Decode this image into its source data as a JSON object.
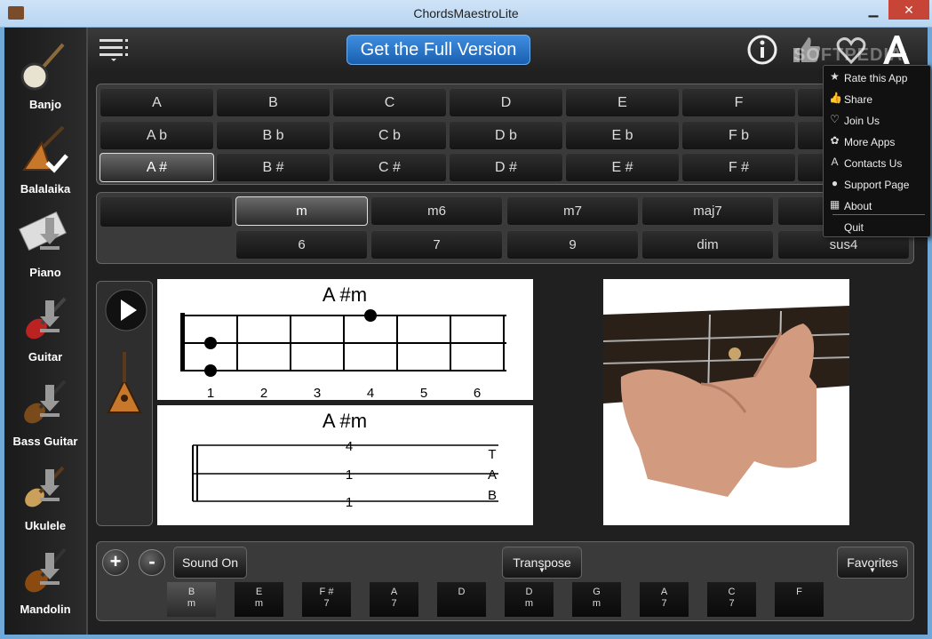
{
  "window": {
    "title": "ChordsMaestroLite",
    "minimize": "▁",
    "maximize": "□",
    "close": "✕"
  },
  "sidebar": {
    "items": [
      {
        "label": "Banjo"
      },
      {
        "label": "Balalaika"
      },
      {
        "label": "Piano"
      },
      {
        "label": "Guitar"
      },
      {
        "label": "Bass Guitar"
      },
      {
        "label": "Ukulele"
      },
      {
        "label": "Mandolin"
      }
    ]
  },
  "topbar": {
    "full_version": "Get the Full Version",
    "watermark": "SOFTPEDIA"
  },
  "notes": {
    "rows": [
      [
        "A",
        "B",
        "C",
        "D",
        "E",
        "F"
      ],
      [
        "A b",
        "B b",
        "C b",
        "D b",
        "E b",
        "F b"
      ],
      [
        "A #",
        "B #",
        "C #",
        "D #",
        "E #",
        "F #"
      ]
    ],
    "selected": "A #"
  },
  "types": {
    "row1": [
      "m",
      "m6",
      "m7",
      "maj7"
    ],
    "row2": [
      "6",
      "7",
      "9",
      "dim",
      "sus4"
    ],
    "selected": "m"
  },
  "chord": {
    "name": "A #m",
    "fret_numbers": [
      "1",
      "2",
      "3",
      "4",
      "5",
      "6"
    ],
    "tab_values": [
      "4",
      "1",
      "1"
    ],
    "tab_letters": [
      "T",
      "A",
      "B"
    ]
  },
  "menu": {
    "items": [
      {
        "label": "Rate this App",
        "icon": "star-icon",
        "glyph": "★"
      },
      {
        "label": "Share",
        "icon": "thumbs-up-icon",
        "glyph": "👍"
      },
      {
        "label": "Join Us",
        "icon": "heart-icon",
        "glyph": "♡"
      },
      {
        "label": "More Apps",
        "icon": "apps-icon",
        "glyph": "✿"
      },
      {
        "label": "Contacts Us",
        "icon": "contacts-icon",
        "glyph": "A"
      },
      {
        "label": "Support Page",
        "icon": "support-icon",
        "glyph": "●"
      },
      {
        "label": "About",
        "icon": "about-icon",
        "glyph": "▦"
      },
      {
        "label": "Quit",
        "icon": "",
        "glyph": ""
      }
    ]
  },
  "bottom": {
    "plus": "+",
    "minus": "-",
    "sound": "Sound On",
    "transpose": "Transpose",
    "favorites": "Favorites",
    "chords": [
      {
        "top": "B",
        "bottom": "m"
      },
      {
        "top": "E",
        "bottom": "m"
      },
      {
        "top": "F #",
        "bottom": "7"
      },
      {
        "top": "A",
        "bottom": "7"
      },
      {
        "top": "D",
        "bottom": ""
      },
      {
        "top": "D",
        "bottom": "m"
      },
      {
        "top": "G",
        "bottom": "m"
      },
      {
        "top": "A",
        "bottom": "7"
      },
      {
        "top": "C",
        "bottom": "7"
      },
      {
        "top": "F",
        "bottom": ""
      }
    ],
    "selected_index": 0
  }
}
